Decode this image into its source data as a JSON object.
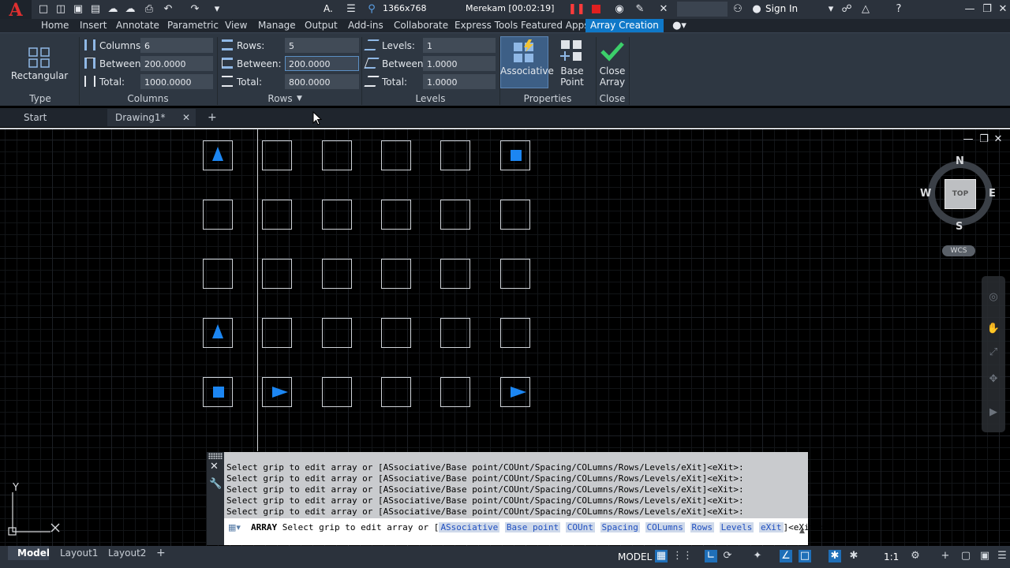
{
  "app": {
    "logo_letter": "A"
  },
  "titlebar": {
    "resolution": "1366x768",
    "recorder": "Merekam [00:02:19]",
    "sign_in": "Sign In",
    "workspace_letter": "A."
  },
  "menu": {
    "tabs": [
      "Home",
      "Insert",
      "Annotate",
      "Parametric",
      "View",
      "Manage",
      "Output",
      "Add-ins",
      "Collaborate",
      "Express Tools",
      "Featured Apps",
      "Array Creation"
    ],
    "active": "Array Creation"
  },
  "ribbon": {
    "type": {
      "button": "Rectangular",
      "title": "Type"
    },
    "columns": {
      "title": "Columns",
      "count_label": "Columns:",
      "count": "6",
      "between_label": "Between:",
      "between": "200.0000",
      "total_label": "Total:",
      "total": "1000.0000"
    },
    "rows": {
      "title": "Rows",
      "count_label": "Rows:",
      "count": "5",
      "between_label": "Between:",
      "between": "200.0000",
      "total_label": "Total:",
      "total": "800.0000"
    },
    "levels": {
      "title": "Levels",
      "count_label": "Levels:",
      "count": "1",
      "between_label": "Between:",
      "between": "1.0000",
      "total_label": "Total:",
      "total": "1.0000"
    },
    "properties": {
      "title": "Properties",
      "associative": "Associative",
      "base_point": "Base Point"
    },
    "close": {
      "title": "Close",
      "line1": "Close",
      "line2": "Array"
    }
  },
  "file_tabs": {
    "start": "Start",
    "drawing": "Drawing1*"
  },
  "viewcube": {
    "n": "N",
    "s": "S",
    "e": "E",
    "w": "W",
    "top": "TOP",
    "wcs": "WCS"
  },
  "ucs": {
    "y": "Y"
  },
  "command": {
    "history": [
      "Select grip to edit array or [ASsociative/Base point/COUnt/Spacing/COLumns/Rows/Levels/eXit]<eXit>:",
      "Select grip to edit array or [ASsociative/Base point/COUnt/Spacing/COLumns/Rows/Levels/eXit]<eXit>:",
      "Select grip to edit array or [ASsociative/Base point/COUnt/Spacing/COLumns/Rows/Levels/eXit]<eXit>:",
      "Select grip to edit array or [ASsociative/Base point/COUnt/Spacing/COLumns/Rows/Levels/eXit]<eXit>:",
      "Select grip to edit array or [ASsociative/Base point/COUnt/Spacing/COLumns/Rows/Levels/eXit]<eXit>:"
    ],
    "prompt_cmd": "ARRAY",
    "prompt_text": "Select grip to edit array or [",
    "options": [
      "ASsociative",
      "Base point",
      "COUnt",
      "Spacing",
      "COLumns",
      "Rows",
      "Levels",
      "eXit"
    ],
    "prompt_end": "]<eXit>:"
  },
  "status": {
    "layout_tabs": [
      "Model",
      "Layout1",
      "Layout2"
    ],
    "model_label": "MODEL",
    "scale": "1:1"
  },
  "colors": {
    "accent": "#0f78c8",
    "grip": "#1c86f2",
    "check": "#3ccf6a"
  }
}
